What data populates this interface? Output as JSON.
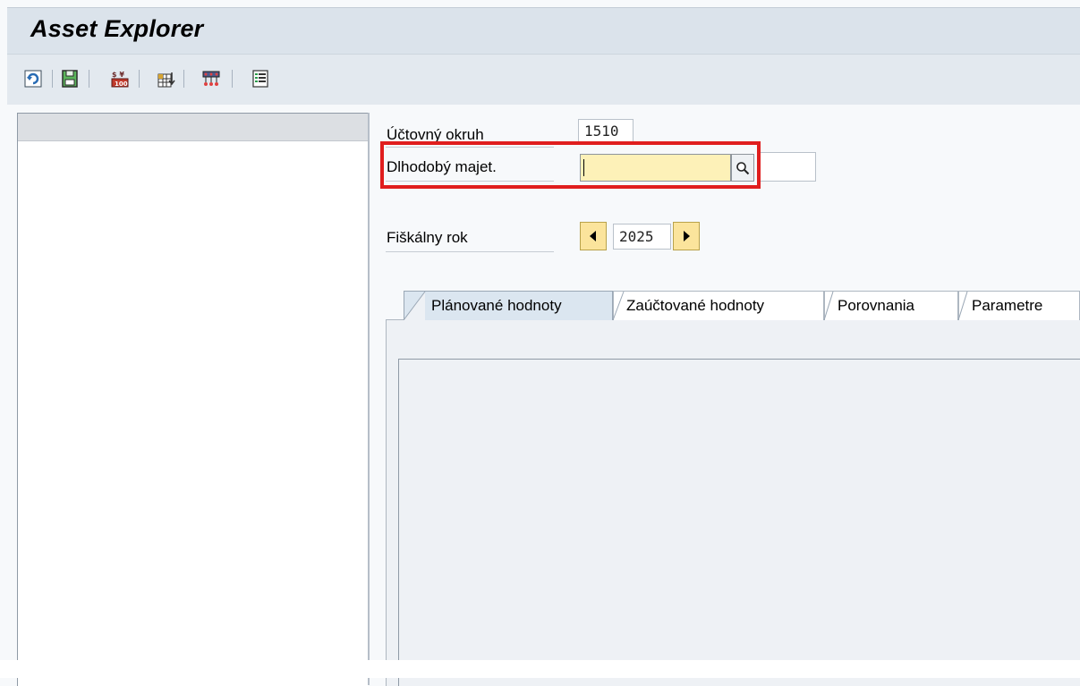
{
  "window": {
    "title": "Asset Explorer"
  },
  "toolbar": {
    "buttons": [
      {
        "icon": "refresh-icon"
      },
      {
        "icon": "save-icon"
      },
      {
        "icon": "currency-icon"
      },
      {
        "icon": "table-icon"
      },
      {
        "icon": "hierarchy-icon"
      },
      {
        "icon": "list-icon"
      }
    ]
  },
  "form": {
    "company_code_label": "Účtovný okruh",
    "company_code_value": "1510",
    "asset_label": "Dlhodobý majet.",
    "asset_value": "",
    "fiscal_year_label": "Fiškálny rok",
    "fiscal_year_value": "2025"
  },
  "tabs": [
    {
      "label": "Plánované hodnoty",
      "active": true
    },
    {
      "label": "Zaúčtované hodnoty",
      "active": false
    },
    {
      "label": "Porovnania",
      "active": false
    },
    {
      "label": "Parametre",
      "active": false
    }
  ],
  "colors": {
    "highlight": "#e01e1e",
    "input_background": "#fdf1b8",
    "nav_button": "#fbe49c",
    "title_bar": "#dbe3eb"
  }
}
